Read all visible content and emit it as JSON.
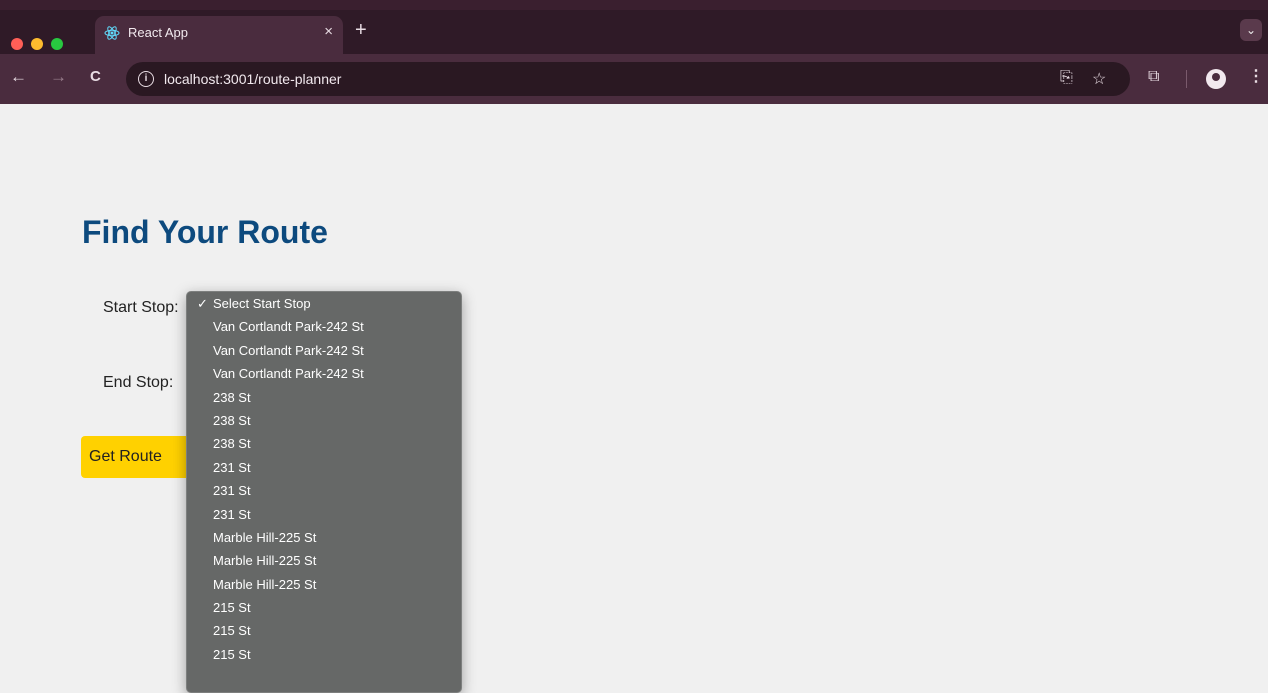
{
  "browser": {
    "tab_title": "React App",
    "tab_close": "×",
    "new_tab": "+",
    "url": "localhost:3001/route-planner",
    "nav": {
      "back": "←",
      "forward": "→",
      "reload": "C"
    }
  },
  "page": {
    "heading": "Find Your Route",
    "start_label": "Start Stop:",
    "end_label": "End Stop:",
    "button_label": "Get Route"
  },
  "dropdown": {
    "check_mark": "✓",
    "options": [
      {
        "label": "Select Start Stop",
        "selected": true
      },
      {
        "label": "Van Cortlandt Park-242 St"
      },
      {
        "label": "Van Cortlandt Park-242 St"
      },
      {
        "label": "Van Cortlandt Park-242 St"
      },
      {
        "label": "238 St"
      },
      {
        "label": "238 St"
      },
      {
        "label": "238 St"
      },
      {
        "label": "231 St"
      },
      {
        "label": "231 St"
      },
      {
        "label": "231 St"
      },
      {
        "label": "Marble Hill-225 St"
      },
      {
        "label": "Marble Hill-225 St"
      },
      {
        "label": "Marble Hill-225 St"
      },
      {
        "label": "215 St"
      },
      {
        "label": "215 St"
      },
      {
        "label": "215 St"
      }
    ]
  },
  "colors": {
    "heading": "#0d4a7e",
    "button": "#ffd100",
    "chrome_bg": "#4a2c3e",
    "dropdown_bg": "#666867"
  },
  "icons": [
    "react-favicon",
    "info-icon",
    "install-icon",
    "star-icon",
    "extensions-icon",
    "profile-icon",
    "menu-icon"
  ]
}
